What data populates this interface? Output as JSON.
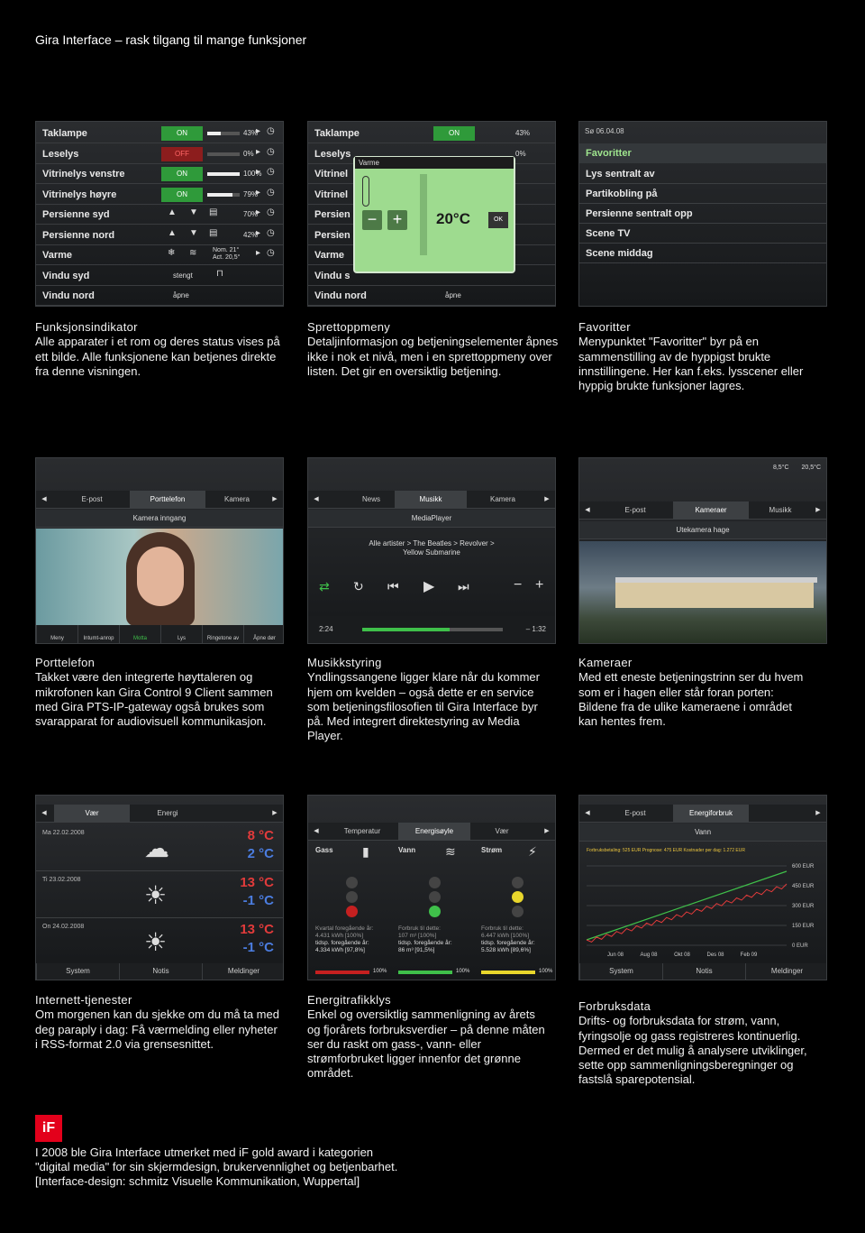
{
  "page_title": "Gira Interface – rask tilgang til mange funksjoner",
  "screen1": {
    "rows": [
      {
        "label": "Taklampe",
        "state": "ON",
        "value": "43%",
        "level": 0.43
      },
      {
        "label": "Leselys",
        "state": "OFF",
        "value": "0%",
        "level": 0
      },
      {
        "label": "Vitrinelys venstre",
        "state": "ON",
        "value": "100%",
        "level": 1
      },
      {
        "label": "Vitrinelys høyre",
        "state": "ON",
        "value": "79%",
        "level": 0.79
      },
      {
        "label": "Persienne syd",
        "value": "70%"
      },
      {
        "label": "Persienne nord",
        "value": "42%"
      },
      {
        "label": "Varme",
        "nom": "Nom. 21°",
        "act": "Act. 20,5°"
      },
      {
        "label": "Vindu syd",
        "status": "stengt"
      },
      {
        "label": "Vindu nord",
        "status": "åpne"
      }
    ]
  },
  "screen2": {
    "rows": [
      "Taklampe",
      "Leselys",
      "Vitrinel",
      "Vitrinel",
      "Persien",
      "Persien",
      "Varme",
      "Vindu s",
      "Vindu nord"
    ],
    "on": "ON",
    "value": "43%",
    "value2": "0%",
    "status_last": "åpne",
    "popup": {
      "title": "Varme",
      "minus": "−",
      "plus": "+",
      "temp": "20°C",
      "ok": "OK"
    }
  },
  "screen3": {
    "date": "Sø 06.04.08",
    "heading": "Favoritter",
    "items": [
      "Lys sentralt av",
      "Partikobling på",
      "Persienne sentralt opp",
      "Scene TV",
      "Scene middag"
    ]
  },
  "cap1": {
    "title": "Funksjonsindikator",
    "body": "Alle apparater i et rom og deres status vises på ett bilde. Alle funksjonene kan betjenes direkte fra denne visningen."
  },
  "cap2": {
    "title": "Sprettoppmeny",
    "body": "Detaljinformasjon og betjeningselementer åpnes ikke i nok et nivå, men i en sprettoppmeny over listen. Det gir en oversiktlig betjening."
  },
  "cap3": {
    "title": "Favoritter",
    "body": "Menypunktet \"Favoritter\" byr på en sammenstilling av de hyppigst brukte innstillingene. Her kan f.eks. lysscener eller hyppig brukte funksjoner lagres."
  },
  "screen4": {
    "tabs": [
      "E-post",
      "Porttelefon",
      "Kamera"
    ],
    "sub": "Kamera inngang",
    "buttons": [
      "Meny",
      "Intumt-anrop",
      "Motta",
      "Lys",
      "Ringetone av",
      "Åpne dør"
    ]
  },
  "screen5": {
    "tabs": [
      "News",
      "Musikk",
      "Kamera"
    ],
    "sub": "MediaPlayer",
    "track_line1": "Alle artister > The Beatles > Revolver >",
    "track_line2": "Yellow Submarine",
    "elapsed": "2:24",
    "remaining": "– 1:32",
    "progress": 0.62
  },
  "screen6": {
    "temp1": "8,5°C",
    "temp2": "20,5°C",
    "tabs": [
      "E-post",
      "Kameraer",
      "Musikk"
    ],
    "sub": "Utekamera hage"
  },
  "cap4": {
    "title": "Porttelefon",
    "body": "Takket være den integrerte høyttaleren og mikrofonen kan Gira Control 9 Client sammen med Gira PTS-IP-gateway også brukes som svarapparat for audiovisuell kommunikasjon."
  },
  "cap5": {
    "title": "Musikkstyring",
    "body": "Yndlingssangene ligger klare når du kommer hjem om kvelden – også dette er en service som betjeningsfilosofien til Gira Interface byr på. Med integrert direktestyring av Media Player."
  },
  "cap6": {
    "title": "Kameraer",
    "body": "Med ett eneste betjeningstrinn ser du hvem som er i hagen eller står foran porten: Bildene fra de ulike kameraene i området kan hentes frem."
  },
  "screen7": {
    "tabs": [
      "Vær",
      "Energi"
    ],
    "days": [
      {
        "date": "Ma 22.02.2008",
        "hi": "8 °C",
        "lo": "2 °C"
      },
      {
        "date": "Ti 23.02.2008",
        "hi": "13 °C",
        "lo": "-1 °C"
      },
      {
        "date": "On 24.02.2008",
        "hi": "13 °C",
        "lo": "-1 °C"
      }
    ],
    "bottom": [
      "System",
      "Notis",
      "Meldinger"
    ]
  },
  "screen8": {
    "tabs": [
      "Temperatur",
      "Energisøyle",
      "Vær"
    ],
    "cols": [
      {
        "name": "Gass",
        "l1": "Kvartal foregående år:",
        "l2": "4.431 kWh [100%]",
        "l3": "tidsp. foregående år:",
        "l4": "4.334 kWh [97,8%]",
        "pct": "100%"
      },
      {
        "name": "Vann",
        "l1": "Forbruk til dette:",
        "l2": "107 m³ [100%]",
        "l3": "tidsp. foregående år:",
        "l4": "86 m³ [91,5%]",
        "pct": "100%"
      },
      {
        "name": "Strøm",
        "l1": "Forbruk til dette:",
        "l2": "6.447 kWh [100%]",
        "l3": "tidsp. foregående år:",
        "l4": "5.528 kWh [89,6%]",
        "pct": "100%"
      }
    ]
  },
  "screen9": {
    "tabs": [
      "E-post",
      "Energiforbruk"
    ],
    "sub": "Vann",
    "legend": "Forbruksbetaling: 525 EUR   Prognose: 475 EUR   Kostnader per dag: 1.272 EUR",
    "y_ticks": [
      "600 EUR",
      "450 EUR",
      "300 EUR",
      "150 EUR",
      "0 EUR"
    ],
    "x_ticks": [
      "Jun 08",
      "Aug 08",
      "Okt 08",
      "Des 08",
      "Feb 09"
    ],
    "bottom": [
      "System",
      "Notis",
      "Meldinger"
    ]
  },
  "cap7": {
    "title": "Internett-tjenester",
    "body": "Om morgenen kan du sjekke om du må ta med deg paraply i dag: Få værmelding eller nyheter i RSS-format 2.0 via grensesnittet."
  },
  "cap8": {
    "title": "Energitrafikklys",
    "body": "Enkel og oversiktlig sammenligning av årets og fjorårets forbruksverdier – på denne måten ser du raskt om gass-, vann- eller strømforbruket ligger innenfor det grønne området."
  },
  "cap9": {
    "title": "Forbruksdata",
    "body": "Drifts- og forbruksdata for strøm, vann, fyringsolje og gass registreres kontinuerlig. Dermed er det mulig å analysere utviklinger, sette opp sammenligningsberegninger og fastslå sparepotensial."
  },
  "award_logo": "iF",
  "footer": [
    "I 2008 ble Gira Interface utmerket med iF gold award i kategorien",
    "\"digital media\" for sin skjermdesign, brukervennlighet og betjenbarhet.",
    "[Interface-design: schmitz Visuelle Kommunikation, Wuppertal]"
  ]
}
